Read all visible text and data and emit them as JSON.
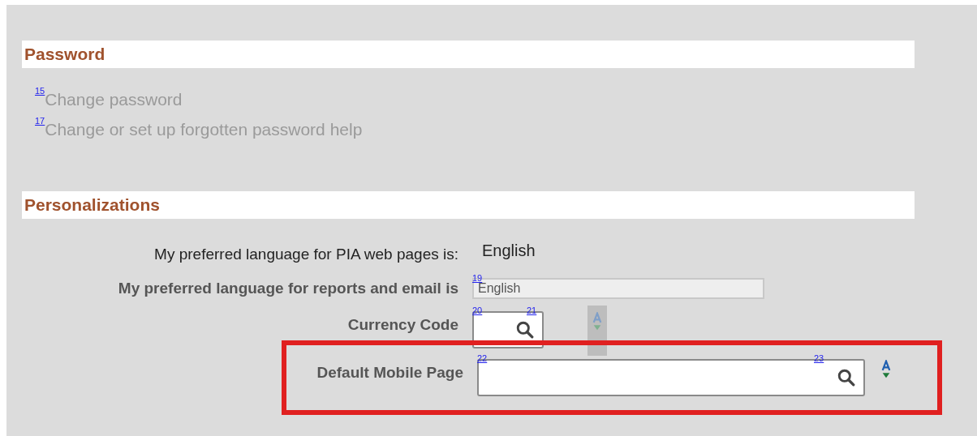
{
  "sections": [
    {
      "title": "Password",
      "links": [
        {
          "hotkey": "15",
          "label": "Change password"
        },
        {
          "hotkey": "17",
          "label": "Change or set up forgotten password help"
        }
      ]
    },
    {
      "title": "Personalizations",
      "fields": [
        {
          "kind": "display",
          "label": "My preferred language for PIA web pages is:",
          "value": "English"
        },
        {
          "kind": "readonly",
          "label": "My preferred language for reports and email is",
          "hotkey": "19",
          "value": "English"
        },
        {
          "kind": "code_lookup",
          "label": "Currency Code",
          "hotkey": "20",
          "lookup_hotkey": "21",
          "disabled": true,
          "highlighted": false
        },
        {
          "kind": "lookup",
          "label": "Default Mobile Page",
          "hotkey": "22",
          "lookup_hotkey": "23",
          "disabled": false,
          "highlighted": true
        }
      ]
    }
  ]
}
